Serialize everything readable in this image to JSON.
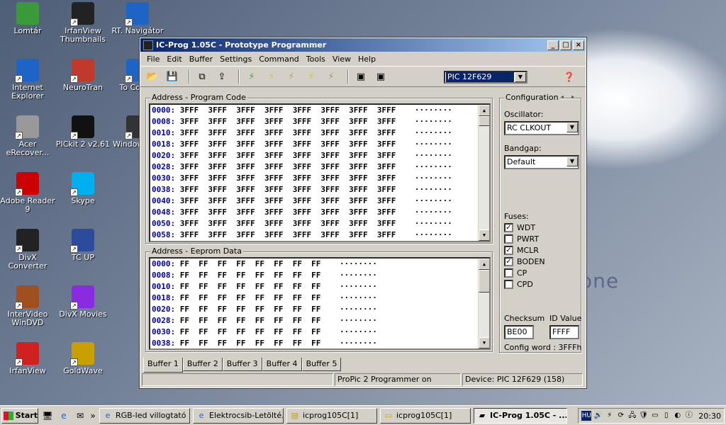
{
  "desktop": {
    "icons": [
      {
        "label": "Lomtár",
        "icon": "recycle-bin-icon"
      },
      {
        "label": "IrfanView Thumbnails",
        "icon": "panda-icon"
      },
      {
        "label": "RT. Navigátor",
        "icon": "rt-navigator-icon"
      },
      {
        "label": "Internet Explorer",
        "icon": "internet-explorer-icon"
      },
      {
        "label": "NeuroTran",
        "icon": "neurotran-icon"
      },
      {
        "label": "To Comm",
        "icon": "tool-icon"
      },
      {
        "label": "Acer eRecover...",
        "icon": "acer-erecovery-icon"
      },
      {
        "label": "PICkit 2 v2.61",
        "icon": "pickit-icon"
      },
      {
        "label": "Window Play",
        "icon": "media-player-icon"
      },
      {
        "label": "Adobe Reader 9",
        "icon": "adobe-reader-icon"
      },
      {
        "label": "Skype",
        "icon": "skype-icon"
      },
      {
        "label": "DivX Converter",
        "icon": "divx-converter-icon"
      },
      {
        "label": "TC UP",
        "icon": "tc-up-icon"
      },
      {
        "label": "InterVideo WinDVD",
        "icon": "windvd-icon"
      },
      {
        "label": "DivX Movies",
        "icon": "divx-movies-icon"
      },
      {
        "label": "IrfanView",
        "icon": "irfanview-icon"
      },
      {
        "label": "GoldWave",
        "icon": "goldwave-icon"
      }
    ],
    "wallpaper_text": "one"
  },
  "window": {
    "title": "IC-Prog 1.05C - Prototype Programmer",
    "menu": [
      "File",
      "Edit",
      "Buffer",
      "Settings",
      "Command",
      "Tools",
      "View",
      "Help"
    ],
    "device_select": "PIC 12F629",
    "program_code": {
      "title": "Address - Program Code",
      "rows": [
        {
          "addr": "0000:",
          "data": "3FFF  3FFF  3FFF  3FFF  3FFF  3FFF  3FFF  3FFF",
          "ascii": "········"
        },
        {
          "addr": "0008:",
          "data": "3FFF  3FFF  3FFF  3FFF  3FFF  3FFF  3FFF  3FFF",
          "ascii": "········"
        },
        {
          "addr": "0010:",
          "data": "3FFF  3FFF  3FFF  3FFF  3FFF  3FFF  3FFF  3FFF",
          "ascii": "········"
        },
        {
          "addr": "0018:",
          "data": "3FFF  3FFF  3FFF  3FFF  3FFF  3FFF  3FFF  3FFF",
          "ascii": "········"
        },
        {
          "addr": "0020:",
          "data": "3FFF  3FFF  3FFF  3FFF  3FFF  3FFF  3FFF  3FFF",
          "ascii": "········"
        },
        {
          "addr": "0028:",
          "data": "3FFF  3FFF  3FFF  3FFF  3FFF  3FFF  3FFF  3FFF",
          "ascii": "········"
        },
        {
          "addr": "0030:",
          "data": "3FFF  3FFF  3FFF  3FFF  3FFF  3FFF  3FFF  3FFF",
          "ascii": "········"
        },
        {
          "addr": "0038:",
          "data": "3FFF  3FFF  3FFF  3FFF  3FFF  3FFF  3FFF  3FFF",
          "ascii": "········"
        },
        {
          "addr": "0040:",
          "data": "3FFF  3FFF  3FFF  3FFF  3FFF  3FFF  3FFF  3FFF",
          "ascii": "········"
        },
        {
          "addr": "0048:",
          "data": "3FFF  3FFF  3FFF  3FFF  3FFF  3FFF  3FFF  3FFF",
          "ascii": "········"
        },
        {
          "addr": "0050:",
          "data": "3FFF  3FFF  3FFF  3FFF  3FFF  3FFF  3FFF  3FFF",
          "ascii": "········"
        },
        {
          "addr": "0058:",
          "data": "3FFF  3FFF  3FFF  3FFF  3FFF  3FFF  3FFF  3FFF",
          "ascii": "········"
        }
      ]
    },
    "eeprom": {
      "title": "Address - Eeprom Data",
      "rows": [
        {
          "addr": "0000:",
          "data": "FF  FF  FF  FF  FF  FF  FF  FF",
          "ascii": "········"
        },
        {
          "addr": "0008:",
          "data": "FF  FF  FF  FF  FF  FF  FF  FF",
          "ascii": "········"
        },
        {
          "addr": "0010:",
          "data": "FF  FF  FF  FF  FF  FF  FF  FF",
          "ascii": "········"
        },
        {
          "addr": "0018:",
          "data": "FF  FF  FF  FF  FF  FF  FF  FF",
          "ascii": "········"
        },
        {
          "addr": "0020:",
          "data": "FF  FF  FF  FF  FF  FF  FF  FF",
          "ascii": "········"
        },
        {
          "addr": "0028:",
          "data": "FF  FF  FF  FF  FF  FF  FF  FF",
          "ascii": "········"
        },
        {
          "addr": "0030:",
          "data": "FF  FF  FF  FF  FF  FF  FF  FF",
          "ascii": "········"
        },
        {
          "addr": "0038:",
          "data": "FF  FF  FF  FF  FF  FF  FF  FF",
          "ascii": "········"
        }
      ]
    },
    "configuration": {
      "title": "Configuration",
      "oscillator_label": "Oscillator:",
      "oscillator_value": "RC CLKOUT",
      "bandgap_label": "Bandgap:",
      "bandgap_value": "Default",
      "fuses_label": "Fuses:",
      "fuses": [
        {
          "label": "WDT",
          "checked": true
        },
        {
          "label": "PWRT",
          "checked": false
        },
        {
          "label": "MCLR",
          "checked": true
        },
        {
          "label": "BODEN",
          "checked": true
        },
        {
          "label": "CP",
          "checked": false
        },
        {
          "label": "CPD",
          "checked": false
        }
      ],
      "checksum_label": "Checksum",
      "checksum_value": "BE00",
      "idvalue_label": "ID Value",
      "idvalue_value": "FFFF",
      "config_word": "Config word : 3FFFh"
    },
    "tabs": [
      "Buffer 1",
      "Buffer 2",
      "Buffer 3",
      "Buffer 4",
      "Buffer 5"
    ],
    "status": {
      "cell1": "",
      "cell2": "ProPic 2 Programmer on",
      "cell3": "Device: PIC 12F629  (158)"
    }
  },
  "taskbar": {
    "start_label": "Start",
    "buttons": [
      {
        "label": "RGB-led villogtató ...",
        "active": false
      },
      {
        "label": "Elektrocsib-Letölté...",
        "active": false
      },
      {
        "label": "icprog105C[1]",
        "active": false
      },
      {
        "label": "icprog105C[1]",
        "active": false
      },
      {
        "label": "IC-Prog 1.05C - ...",
        "active": true
      }
    ],
    "lang": "HU",
    "clock": "20:30"
  }
}
